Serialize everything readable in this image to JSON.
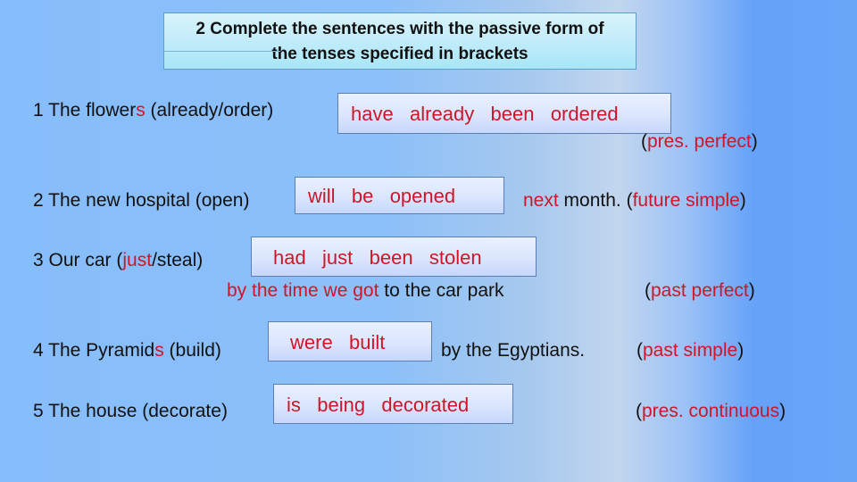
{
  "title": {
    "line1": "2 Complete the sentences with the passive form of",
    "line2": "the tenses specified in brackets"
  },
  "colors": {
    "answer_text": "#d01528",
    "body_text": "#111111",
    "title_box_bg": "#c2ecf9",
    "answer_box_border": "#5d7fb5"
  },
  "items": [
    {
      "num": "1",
      "prompt_a": "The flower",
      "prompt_red": "s",
      "prompt_b": " (already/order)",
      "answer": "have   already   been   ordered",
      "tense_open": "(",
      "tense": "pres. perfect",
      "tense_close": ")"
    },
    {
      "num": "2",
      "prompt": "The new hospital (open)",
      "answer": "will   be   opened",
      "after_red": "next",
      "after": " month. (",
      "tense": "future simple",
      "tense_close": ")"
    },
    {
      "num": "3",
      "prompt_a": "Our car (",
      "prompt_red": "just",
      "prompt_b": "/steal)",
      "answer": "had   just   been   stolen",
      "line2_red": "by the time we got",
      "line2": " to the car park",
      "tense_open": "(",
      "tense": "past perfect",
      "tense_close": ")"
    },
    {
      "num": "4",
      "prompt_a": "The Pyramid",
      "prompt_red": "s",
      "prompt_b": " (build)",
      "answer": "were   built",
      "after": "by the Egyptians.",
      "tense_open": "(",
      "tense": "past simple",
      "tense_close": ")"
    },
    {
      "num": "5",
      "prompt": "The house (decorate)",
      "answer": "is   being   decorated",
      "tense_open": "(",
      "tense": "pres. continuous",
      "tense_close": ")"
    }
  ]
}
